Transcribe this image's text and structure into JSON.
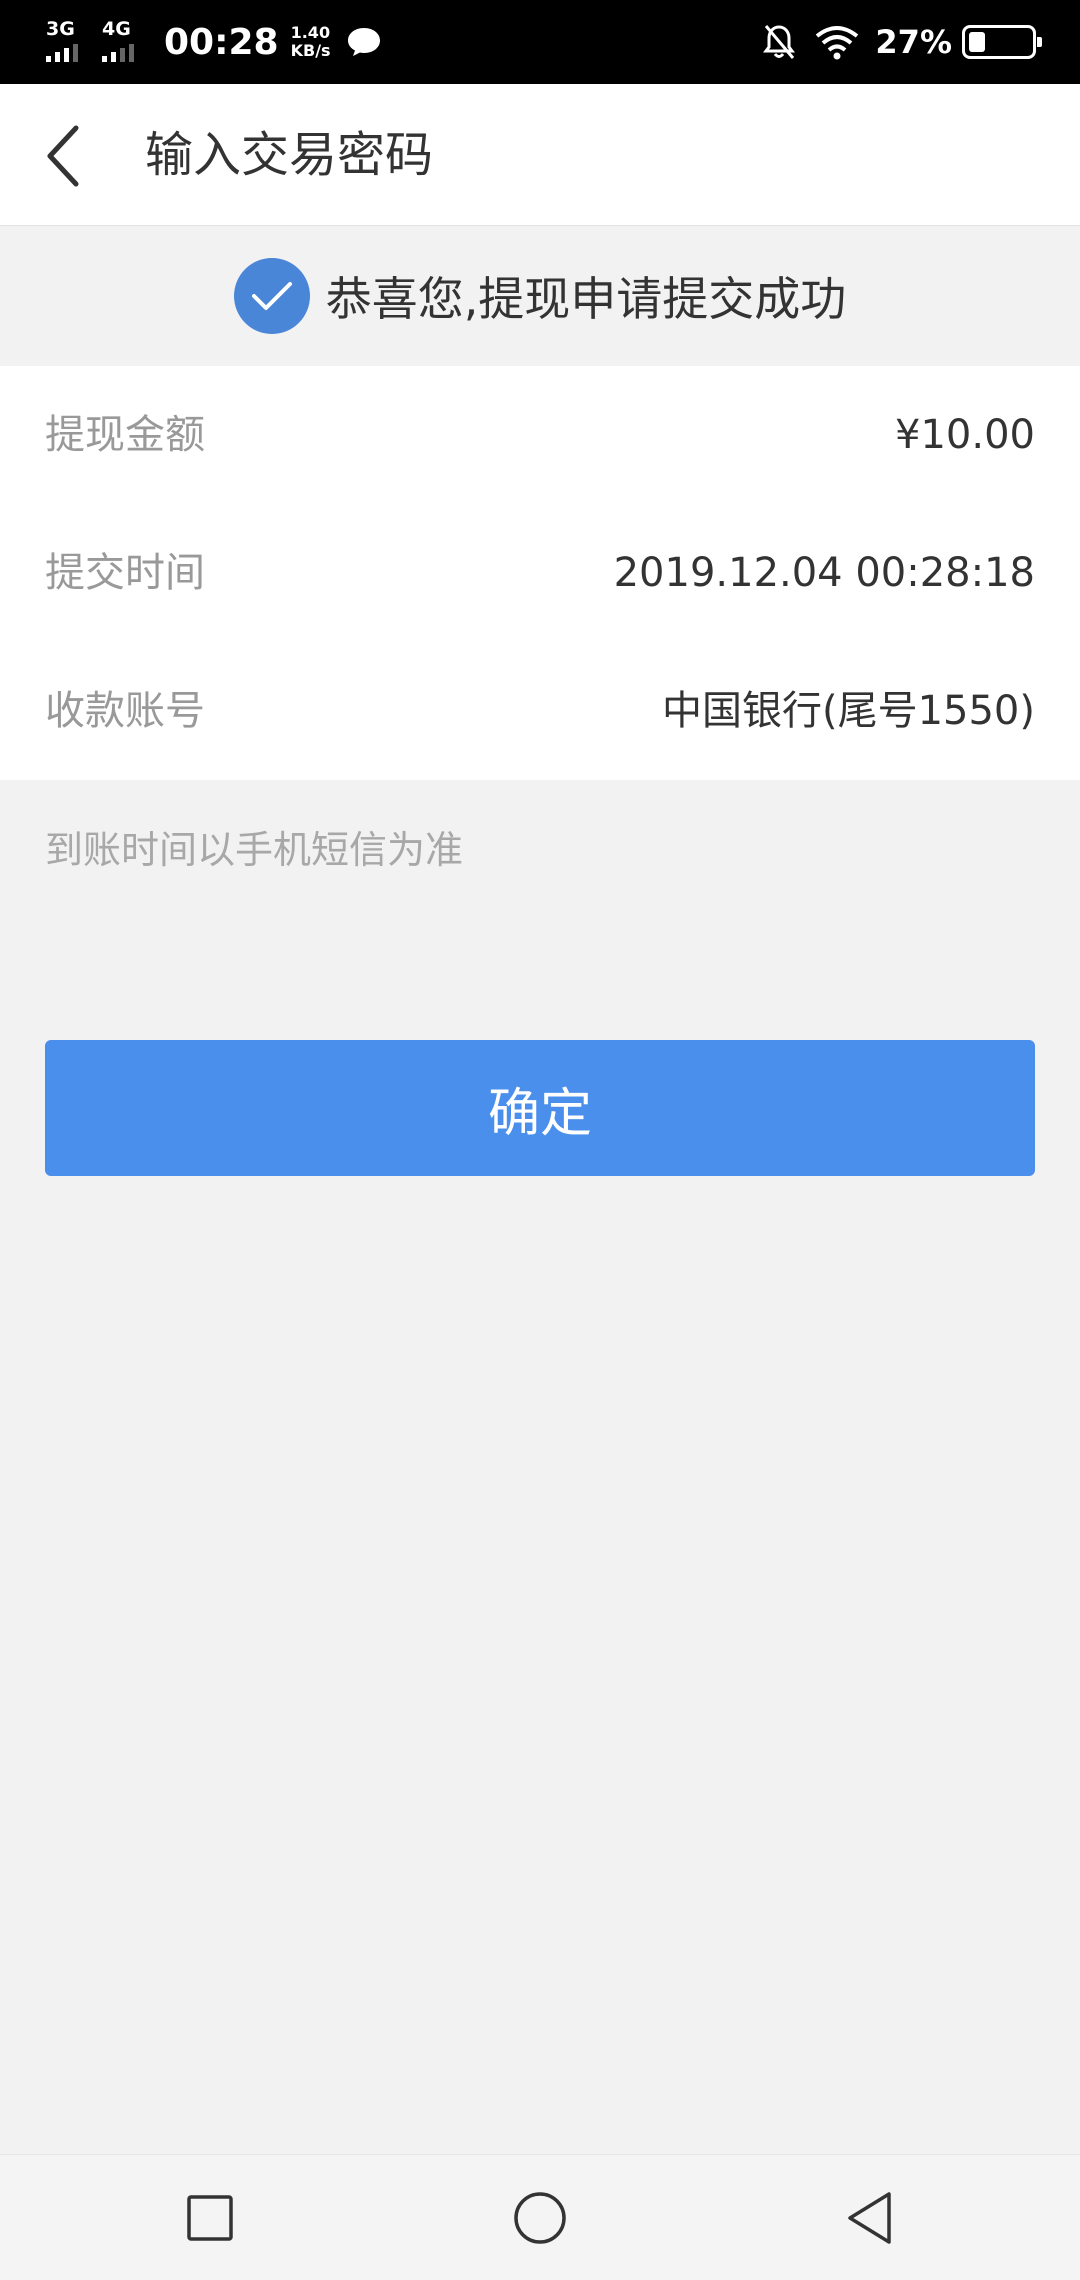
{
  "status_bar": {
    "network1": "3G",
    "network2": "4G",
    "time": "00:28",
    "speed_value": "1.40",
    "speed_unit": "KB/s",
    "battery_percent": "27%",
    "battery_level": 0.27,
    "icons": [
      "message-icon",
      "mute-bell-icon",
      "wifi-icon",
      "battery-icon"
    ]
  },
  "header": {
    "title": "输入交易密码",
    "back_icon": "chevron-left-icon"
  },
  "banner": {
    "icon": "check-circle-icon",
    "icon_color": "#4a86d8",
    "message": "恭喜您,提现申请提交成功"
  },
  "details": [
    {
      "label": "提现金额",
      "value": "¥10.00"
    },
    {
      "label": "提交时间",
      "value": "2019.12.04 00:28:18"
    },
    {
      "label": "收款账号",
      "value": "中国银行(尾号1550)"
    }
  ],
  "note": "到账时间以手机短信为准",
  "confirm_button": {
    "label": "确定",
    "color": "#4a8fec"
  },
  "nav_bar": {
    "icons": [
      "recent-apps-icon",
      "home-icon",
      "back-triangle-icon"
    ]
  }
}
